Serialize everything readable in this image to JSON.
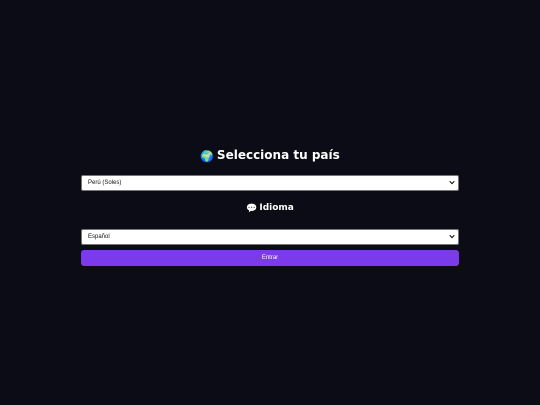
{
  "country_section": {
    "icon": "globe-icon",
    "title": "Selecciona tu país",
    "selected_option": "Perú (Soles)"
  },
  "language_section": {
    "icon": "speech-bubble-icon",
    "title": "Idioma",
    "selected_option": "Español"
  },
  "enter_button": {
    "label": "Entrar"
  },
  "colors": {
    "background": "#0b0c16",
    "accent": "#7c3aed",
    "text": "#ffffff"
  }
}
